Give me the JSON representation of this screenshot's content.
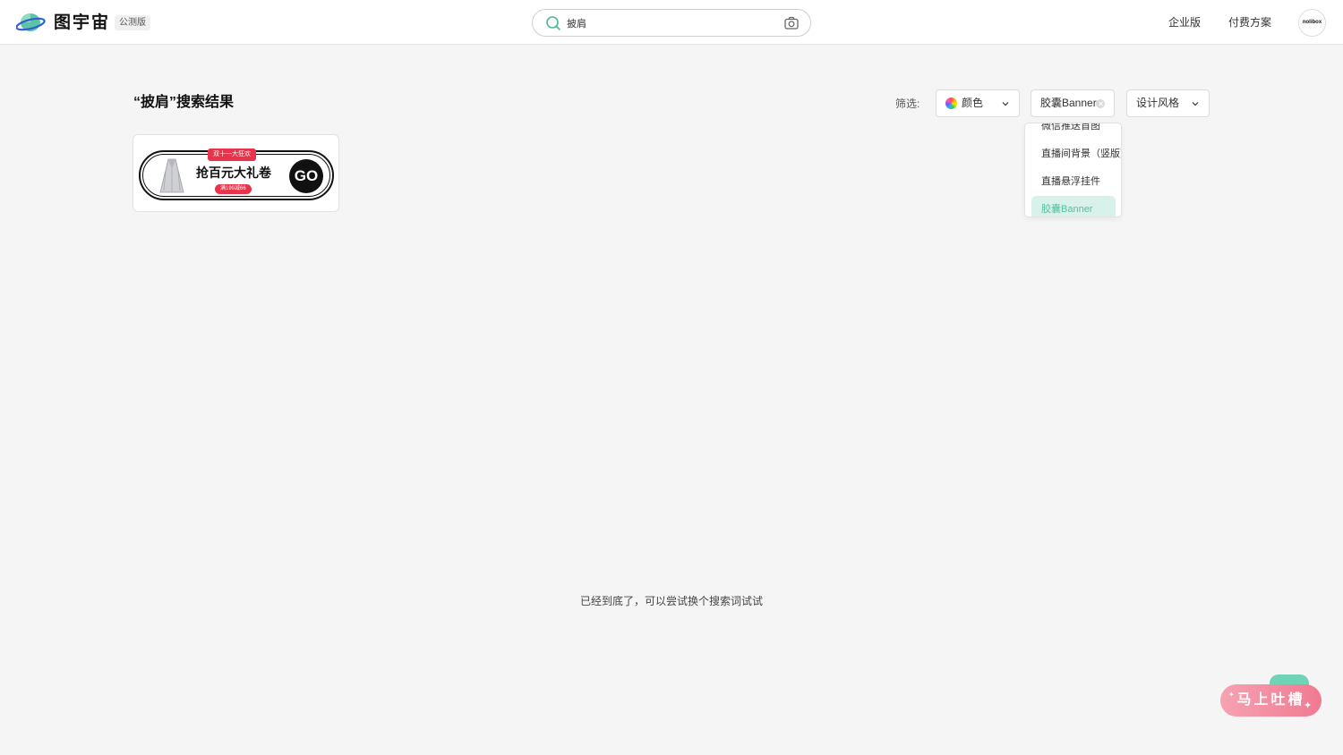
{
  "header": {
    "brand": "图宇宙",
    "beta_badge": "公测版",
    "search": {
      "value": "披肩",
      "placeholder": ""
    },
    "nav": {
      "enterprise": "企业版",
      "pricing": "付费方案"
    },
    "avatar_text": "nolibox"
  },
  "main": {
    "title": "“披肩”搜索结果",
    "filter_label": "筛选:",
    "filters": {
      "color": "颜色",
      "selected_type": "胶囊Banner",
      "style": "设计风格"
    },
    "dropdown": {
      "items": [
        "微信推送首图",
        "直播间背景（竖版）",
        "直播悬浮挂件",
        "胶囊Banner"
      ]
    },
    "result_card": {
      "top_tag": "双十一大狂欢",
      "title": "抢百元大礼卷",
      "bottom_tag": "满199减66",
      "go": "GO"
    },
    "end_message": "已经到底了，可以尝试换个搜索词试试"
  },
  "feedback": {
    "label": "马上吐槽"
  },
  "colors": {
    "accent": "#55c0a0",
    "selected_bg": "#d8f1ea",
    "feedback": "#f07a91",
    "banner_red": "#e8334a"
  }
}
